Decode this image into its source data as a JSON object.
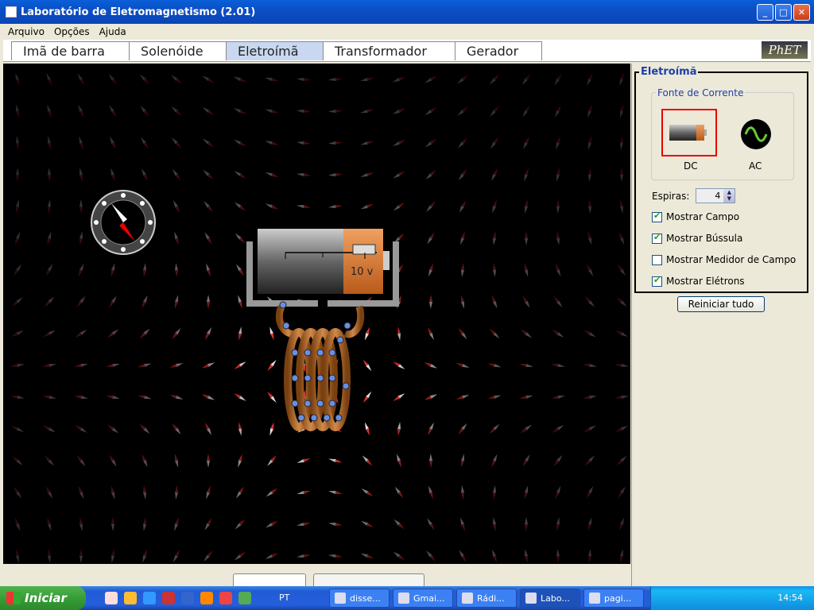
{
  "window": {
    "title": "Laboratório de Eletromagnetismo (2.01)"
  },
  "menu": [
    "Arquivo",
    "Opções",
    "Ajuda"
  ],
  "tabs": [
    {
      "label": "Imã de barra",
      "active": false
    },
    {
      "label": "Solenóide",
      "active": false
    },
    {
      "label": "Eletroímã",
      "active": true
    },
    {
      "label": "Transformador",
      "active": false
    },
    {
      "label": "Gerador",
      "active": false
    }
  ],
  "logo": "PhET",
  "battery": {
    "voltage_label": "10 v"
  },
  "panel": {
    "title": "Eletroímã",
    "source_title": "Fonte de Corrente",
    "dc_label": "DC",
    "ac_label": "AC",
    "selected_source": "DC",
    "loops_label": "Espiras:",
    "loops_value": "4",
    "checkboxes": [
      {
        "label": "Mostrar Campo",
        "checked": true
      },
      {
        "label": "Mostrar Bússula",
        "checked": true
      },
      {
        "label": "Mostrar Medidor de Campo",
        "checked": false
      },
      {
        "label": "Mostrar Elétrons",
        "checked": true
      }
    ],
    "reset_label": "Reiniciar tudo"
  },
  "taskbar": {
    "start_label": "Iniciar",
    "language": "PT",
    "tasks": [
      {
        "label": "disse...",
        "active": false
      },
      {
        "label": "Gmai...",
        "active": false
      },
      {
        "label": "Rádi...",
        "active": false
      },
      {
        "label": "Labo...",
        "active": true
      },
      {
        "label": "pagi...",
        "active": false
      }
    ],
    "clock": "14:54"
  },
  "colors": {
    "accent": "#1d3fae",
    "sim_bg": "#000000",
    "coil": "#b07030",
    "selected": "#e00000"
  }
}
